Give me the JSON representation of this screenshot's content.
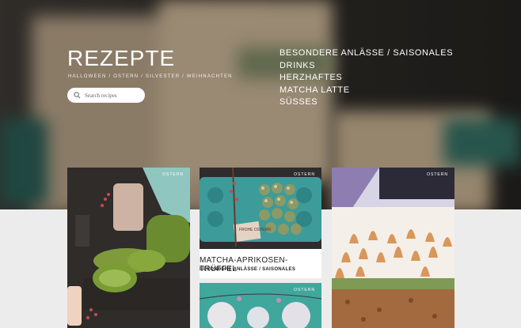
{
  "hero": {
    "title": "REZEPTE",
    "subtitle": "HALLOWEEN / OSTERN / SILVESTER / WEIHNACHTEN",
    "search_placeholder": "Search recipes"
  },
  "categories": [
    "BESONDERE ANLÄSSE / SAISONALES",
    "DRINKS",
    "HERZHAFTES",
    "MATCHA LATTE",
    "SÜSSES"
  ],
  "cards": [
    {
      "tag": "OSTERN"
    },
    {
      "tag": "OSTERN",
      "name": "MATCHA-APRIKOSEN-TRÜFFEL",
      "category": "BESONDERE ANLÄSSE / SAISONALES",
      "label_text": "FROHE OSTERN"
    },
    {
      "tag": "OSTERN"
    },
    {
      "tag": "OSTERN"
    }
  ]
}
